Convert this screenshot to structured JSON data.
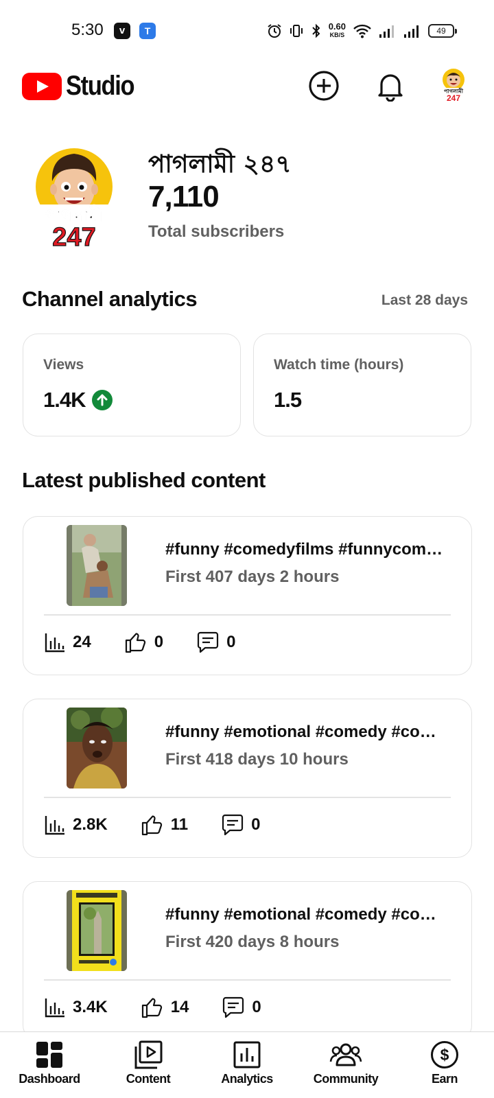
{
  "status_bar": {
    "time": "5:30",
    "net_speed": "0.60",
    "net_unit": "KB/S",
    "battery": "49"
  },
  "header": {
    "app_name": "Studio"
  },
  "channel": {
    "name": "পাগলামী ২৪৭",
    "subscribers": "7,110",
    "subscribers_label": "Total subscribers",
    "avatar_text_top": "পাগলামী",
    "avatar_text_bottom": "247"
  },
  "analytics": {
    "title": "Channel analytics",
    "range": "Last 28 days",
    "views_label": "Views",
    "views_value": "1.4K",
    "views_trend": "up",
    "watch_label": "Watch time (hours)",
    "watch_value": "1.5"
  },
  "latest": {
    "title": "Latest published content",
    "items": [
      {
        "title": "#funny #comedyfilms #funnycomedy #comedy",
        "meta": "First 407 days 2 hours",
        "views": "24",
        "likes": "0",
        "comments": "0"
      },
      {
        "title": "#funny #emotional #comedy #comedyfilms",
        "meta": "First 418 days 10 hours",
        "views": "2.8K",
        "likes": "11",
        "comments": "0"
      },
      {
        "title": "#funny #emotional #comedy #comedyfilms",
        "meta": "First 420 days 8 hours",
        "views": "3.4K",
        "likes": "14",
        "comments": "0"
      }
    ]
  },
  "nav": {
    "dashboard": "Dashboard",
    "content": "Content",
    "analytics": "Analytics",
    "community": "Community",
    "earn": "Earn"
  },
  "colors": {
    "brand_red": "#ff0000",
    "trend_green": "#128a3a",
    "muted_text": "#606060"
  }
}
